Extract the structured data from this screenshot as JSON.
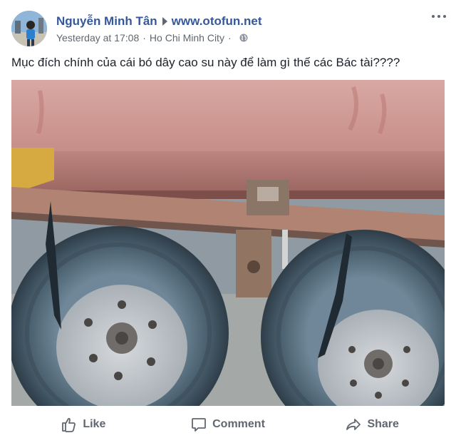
{
  "post": {
    "author": "Nguyễn Minh Tân",
    "page": "www.otofun.net",
    "timestamp": "Yesterday at 17:08",
    "separator": "·",
    "location": "Ho Chi Minh City",
    "privacy_icon": "globe-icon",
    "text": "Mục đích chính của cái bó dây cao su này để làm gì thế các Bác tài????",
    "photo_description_icon": "truck-wheels-photo"
  },
  "actions": {
    "like": "Like",
    "comment": "Comment",
    "share": "Share"
  },
  "colors": {
    "link": "#365899",
    "meta": "#606770",
    "text": "#1d2129"
  }
}
